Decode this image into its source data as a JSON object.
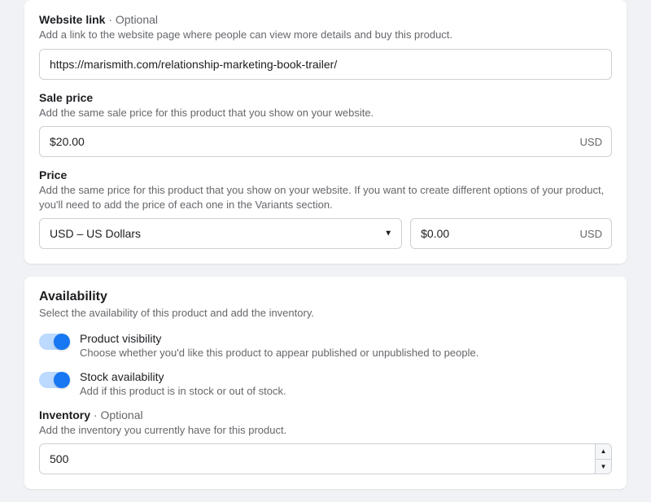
{
  "website_link": {
    "label": "Website link",
    "optional": " · Optional",
    "desc": "Add a link to the website page where people can view more details and buy this product.",
    "value": "https://marismith.com/relationship-marketing-book-trailer/"
  },
  "sale_price": {
    "label": "Sale price",
    "desc": "Add the same sale price for this product that you show on your website.",
    "value": "$20.00",
    "currency": "USD"
  },
  "price": {
    "label": "Price",
    "desc": "Add the same price for this product that you show on your website. If you want to create different options of your product, you'll need to add the price of each one in the Variants section.",
    "currency_select": "USD – US Dollars",
    "value": "$0.00",
    "currency": "USD"
  },
  "availability": {
    "title": "Availability",
    "desc": "Select the availability of this product and add the inventory.",
    "visibility": {
      "title": "Product visibility",
      "desc": "Choose whether you'd like this product to appear published or unpublished to people."
    },
    "stock": {
      "title": "Stock availability",
      "desc": "Add if this product is in stock or out of stock."
    },
    "inventory": {
      "label": "Inventory",
      "optional": " · Optional",
      "desc": "Add the inventory you currently have for this product.",
      "value": "500"
    }
  }
}
